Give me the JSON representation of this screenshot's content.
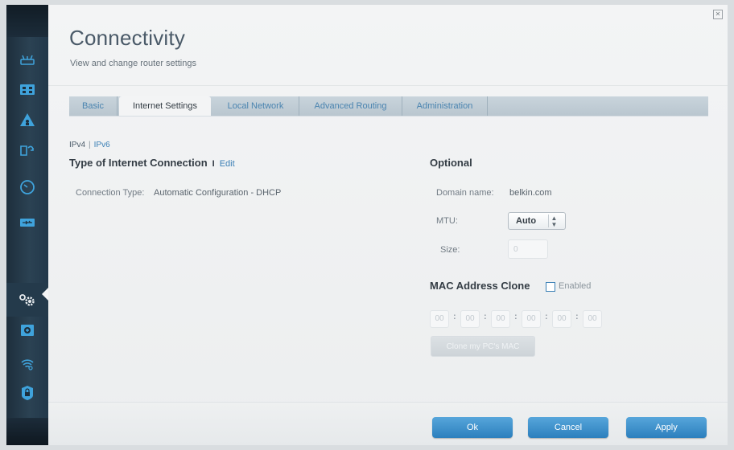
{
  "header": {
    "title": "Connectivity",
    "subtitle": "View and change router settings"
  },
  "tabs": [
    {
      "label": "Basic"
    },
    {
      "label": "Internet Settings"
    },
    {
      "label": "Local Network"
    },
    {
      "label": "Advanced Routing"
    },
    {
      "label": "Administration"
    }
  ],
  "ip_toggle": {
    "ipv4": "IPv4",
    "separator": "|",
    "ipv6": "IPv6"
  },
  "internet_connection": {
    "title": "Type of Internet Connection",
    "separator": "I",
    "edit_label": "Edit",
    "connection_type_label": "Connection Type:",
    "connection_type_value": "Automatic Configuration - DHCP"
  },
  "optional": {
    "title": "Optional",
    "domain_label": "Domain name:",
    "domain_value": "belkin.com",
    "mtu_label": "MTU:",
    "mtu_value": "Auto",
    "mtu_arrows": "▲▼",
    "size_label": "Size:",
    "size_value": "0"
  },
  "mac_clone": {
    "title": "MAC Address Clone",
    "enabled_label": "Enabled",
    "fields": [
      "00",
      "00",
      "00",
      "00",
      "00",
      "00"
    ],
    "separator": ":",
    "clone_button": "Clone my PC's MAC"
  },
  "footer": {
    "ok_label": "Ok",
    "cancel_label": "Cancel",
    "apply_label": "Apply"
  },
  "sidebar": {
    "icons": [
      "router-icon",
      "device-list-icon",
      "parental-controls-icon",
      "media-prioritization-icon",
      "speed-test-icon",
      "usb-storage-icon",
      "connectivity-gear-icon",
      "troubleshooting-icon",
      "wireless-icon",
      "security-icon"
    ]
  },
  "colors": {
    "accent": "#3a7fb5",
    "button": "#3c8ecb",
    "sidebar": "#2b4253"
  }
}
